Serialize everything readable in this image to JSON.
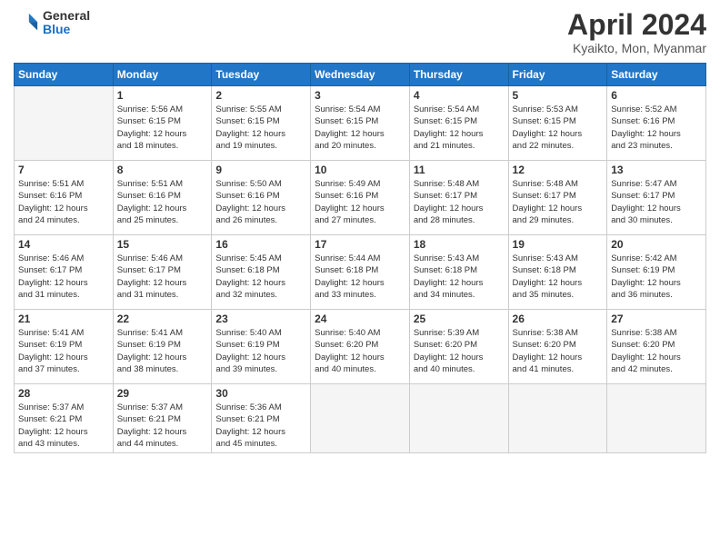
{
  "header": {
    "logo_general": "General",
    "logo_blue": "Blue",
    "title": "April 2024",
    "subtitle": "Kyaikto, Mon, Myanmar"
  },
  "weekdays": [
    "Sunday",
    "Monday",
    "Tuesday",
    "Wednesday",
    "Thursday",
    "Friday",
    "Saturday"
  ],
  "weeks": [
    [
      {
        "day": "",
        "info": ""
      },
      {
        "day": "1",
        "info": "Sunrise: 5:56 AM\nSunset: 6:15 PM\nDaylight: 12 hours\nand 18 minutes."
      },
      {
        "day": "2",
        "info": "Sunrise: 5:55 AM\nSunset: 6:15 PM\nDaylight: 12 hours\nand 19 minutes."
      },
      {
        "day": "3",
        "info": "Sunrise: 5:54 AM\nSunset: 6:15 PM\nDaylight: 12 hours\nand 20 minutes."
      },
      {
        "day": "4",
        "info": "Sunrise: 5:54 AM\nSunset: 6:15 PM\nDaylight: 12 hours\nand 21 minutes."
      },
      {
        "day": "5",
        "info": "Sunrise: 5:53 AM\nSunset: 6:15 PM\nDaylight: 12 hours\nand 22 minutes."
      },
      {
        "day": "6",
        "info": "Sunrise: 5:52 AM\nSunset: 6:16 PM\nDaylight: 12 hours\nand 23 minutes."
      }
    ],
    [
      {
        "day": "7",
        "info": "Sunrise: 5:51 AM\nSunset: 6:16 PM\nDaylight: 12 hours\nand 24 minutes."
      },
      {
        "day": "8",
        "info": "Sunrise: 5:51 AM\nSunset: 6:16 PM\nDaylight: 12 hours\nand 25 minutes."
      },
      {
        "day": "9",
        "info": "Sunrise: 5:50 AM\nSunset: 6:16 PM\nDaylight: 12 hours\nand 26 minutes."
      },
      {
        "day": "10",
        "info": "Sunrise: 5:49 AM\nSunset: 6:16 PM\nDaylight: 12 hours\nand 27 minutes."
      },
      {
        "day": "11",
        "info": "Sunrise: 5:48 AM\nSunset: 6:17 PM\nDaylight: 12 hours\nand 28 minutes."
      },
      {
        "day": "12",
        "info": "Sunrise: 5:48 AM\nSunset: 6:17 PM\nDaylight: 12 hours\nand 29 minutes."
      },
      {
        "day": "13",
        "info": "Sunrise: 5:47 AM\nSunset: 6:17 PM\nDaylight: 12 hours\nand 30 minutes."
      }
    ],
    [
      {
        "day": "14",
        "info": "Sunrise: 5:46 AM\nSunset: 6:17 PM\nDaylight: 12 hours\nand 31 minutes."
      },
      {
        "day": "15",
        "info": "Sunrise: 5:46 AM\nSunset: 6:17 PM\nDaylight: 12 hours\nand 31 minutes."
      },
      {
        "day": "16",
        "info": "Sunrise: 5:45 AM\nSunset: 6:18 PM\nDaylight: 12 hours\nand 32 minutes."
      },
      {
        "day": "17",
        "info": "Sunrise: 5:44 AM\nSunset: 6:18 PM\nDaylight: 12 hours\nand 33 minutes."
      },
      {
        "day": "18",
        "info": "Sunrise: 5:43 AM\nSunset: 6:18 PM\nDaylight: 12 hours\nand 34 minutes."
      },
      {
        "day": "19",
        "info": "Sunrise: 5:43 AM\nSunset: 6:18 PM\nDaylight: 12 hours\nand 35 minutes."
      },
      {
        "day": "20",
        "info": "Sunrise: 5:42 AM\nSunset: 6:19 PM\nDaylight: 12 hours\nand 36 minutes."
      }
    ],
    [
      {
        "day": "21",
        "info": "Sunrise: 5:41 AM\nSunset: 6:19 PM\nDaylight: 12 hours\nand 37 minutes."
      },
      {
        "day": "22",
        "info": "Sunrise: 5:41 AM\nSunset: 6:19 PM\nDaylight: 12 hours\nand 38 minutes."
      },
      {
        "day": "23",
        "info": "Sunrise: 5:40 AM\nSunset: 6:19 PM\nDaylight: 12 hours\nand 39 minutes."
      },
      {
        "day": "24",
        "info": "Sunrise: 5:40 AM\nSunset: 6:20 PM\nDaylight: 12 hours\nand 40 minutes."
      },
      {
        "day": "25",
        "info": "Sunrise: 5:39 AM\nSunset: 6:20 PM\nDaylight: 12 hours\nand 40 minutes."
      },
      {
        "day": "26",
        "info": "Sunrise: 5:38 AM\nSunset: 6:20 PM\nDaylight: 12 hours\nand 41 minutes."
      },
      {
        "day": "27",
        "info": "Sunrise: 5:38 AM\nSunset: 6:20 PM\nDaylight: 12 hours\nand 42 minutes."
      }
    ],
    [
      {
        "day": "28",
        "info": "Sunrise: 5:37 AM\nSunset: 6:21 PM\nDaylight: 12 hours\nand 43 minutes."
      },
      {
        "day": "29",
        "info": "Sunrise: 5:37 AM\nSunset: 6:21 PM\nDaylight: 12 hours\nand 44 minutes."
      },
      {
        "day": "30",
        "info": "Sunrise: 5:36 AM\nSunset: 6:21 PM\nDaylight: 12 hours\nand 45 minutes."
      },
      {
        "day": "",
        "info": ""
      },
      {
        "day": "",
        "info": ""
      },
      {
        "day": "",
        "info": ""
      },
      {
        "day": "",
        "info": ""
      }
    ]
  ]
}
